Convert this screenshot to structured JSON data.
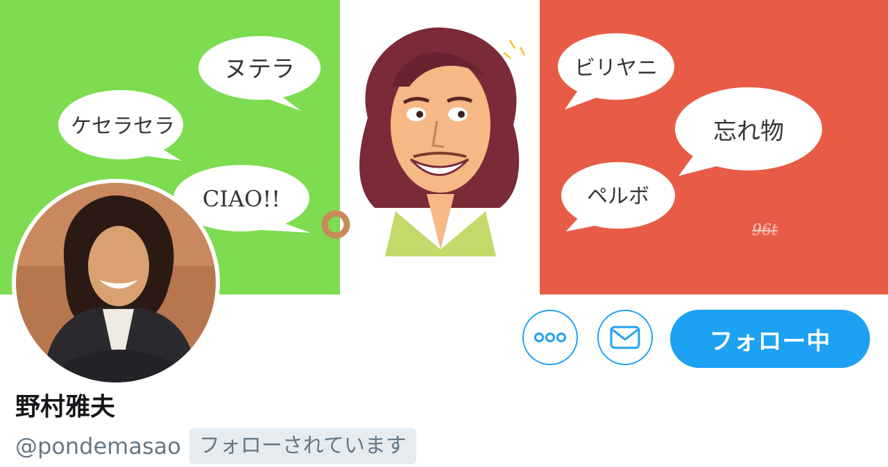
{
  "banner": {
    "bubbles_left": [
      "ヌテラ",
      "ケセラセラ",
      "CIAO!!"
    ],
    "bubbles_right": [
      "ビリヤニ",
      "忘れ物",
      "ペルボ"
    ],
    "signature": "96t",
    "colors": {
      "left": "#7ddc4f",
      "middle": "#ffffff",
      "right": "#e85c47"
    }
  },
  "actions": {
    "more_icon": "more-dots-icon",
    "dm_icon": "envelope-icon",
    "follow_label": "フォロー中"
  },
  "profile": {
    "display_name": "野村雅夫",
    "handle": "@pondemasao",
    "follows_you": "フォローされています"
  },
  "colors": {
    "accent": "#1da1f2",
    "text": "#14171a",
    "muted": "#657786",
    "badge_bg": "#e6ecf0"
  }
}
